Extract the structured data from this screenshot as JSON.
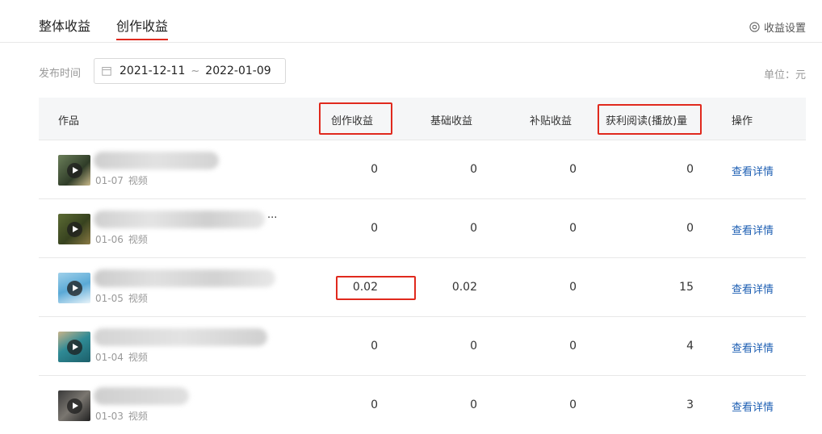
{
  "tabs": [
    {
      "label": "整体收益"
    },
    {
      "label": "创作收益"
    }
  ],
  "settings": {
    "label": "收益设置",
    "icon": "gear-icon"
  },
  "filter": {
    "label": "发布时间",
    "start_date": "2021-12-11",
    "separator": "~",
    "end_date": "2022-01-09"
  },
  "unit": "单位：元",
  "table": {
    "columns": [
      "作品",
      "创作收益",
      "基础收益",
      "补贴收益",
      "获利阅读(播放)量",
      "操作"
    ],
    "rows": [
      {
        "date": "01-07",
        "type": "视频",
        "creation": "0",
        "base": "0",
        "subsidy": "0",
        "views": "0",
        "action": "查看详情"
      },
      {
        "date": "01-06",
        "type": "视频",
        "creation": "0",
        "base": "0",
        "subsidy": "0",
        "views": "0",
        "action": "查看详情",
        "title_ellipsis": "..."
      },
      {
        "date": "01-05",
        "type": "视频",
        "creation": "0.02",
        "base": "0.02",
        "subsidy": "0",
        "views": "15",
        "action": "查看详情"
      },
      {
        "date": "01-04",
        "type": "视频",
        "creation": "0",
        "base": "0",
        "subsidy": "0",
        "views": "4",
        "action": "查看详情"
      },
      {
        "date": "01-03",
        "type": "视频",
        "creation": "0",
        "base": "0",
        "subsidy": "0",
        "views": "3",
        "action": "查看详情"
      }
    ]
  },
  "colors": {
    "accent": "#e0291d",
    "link": "#1e5fb3"
  }
}
